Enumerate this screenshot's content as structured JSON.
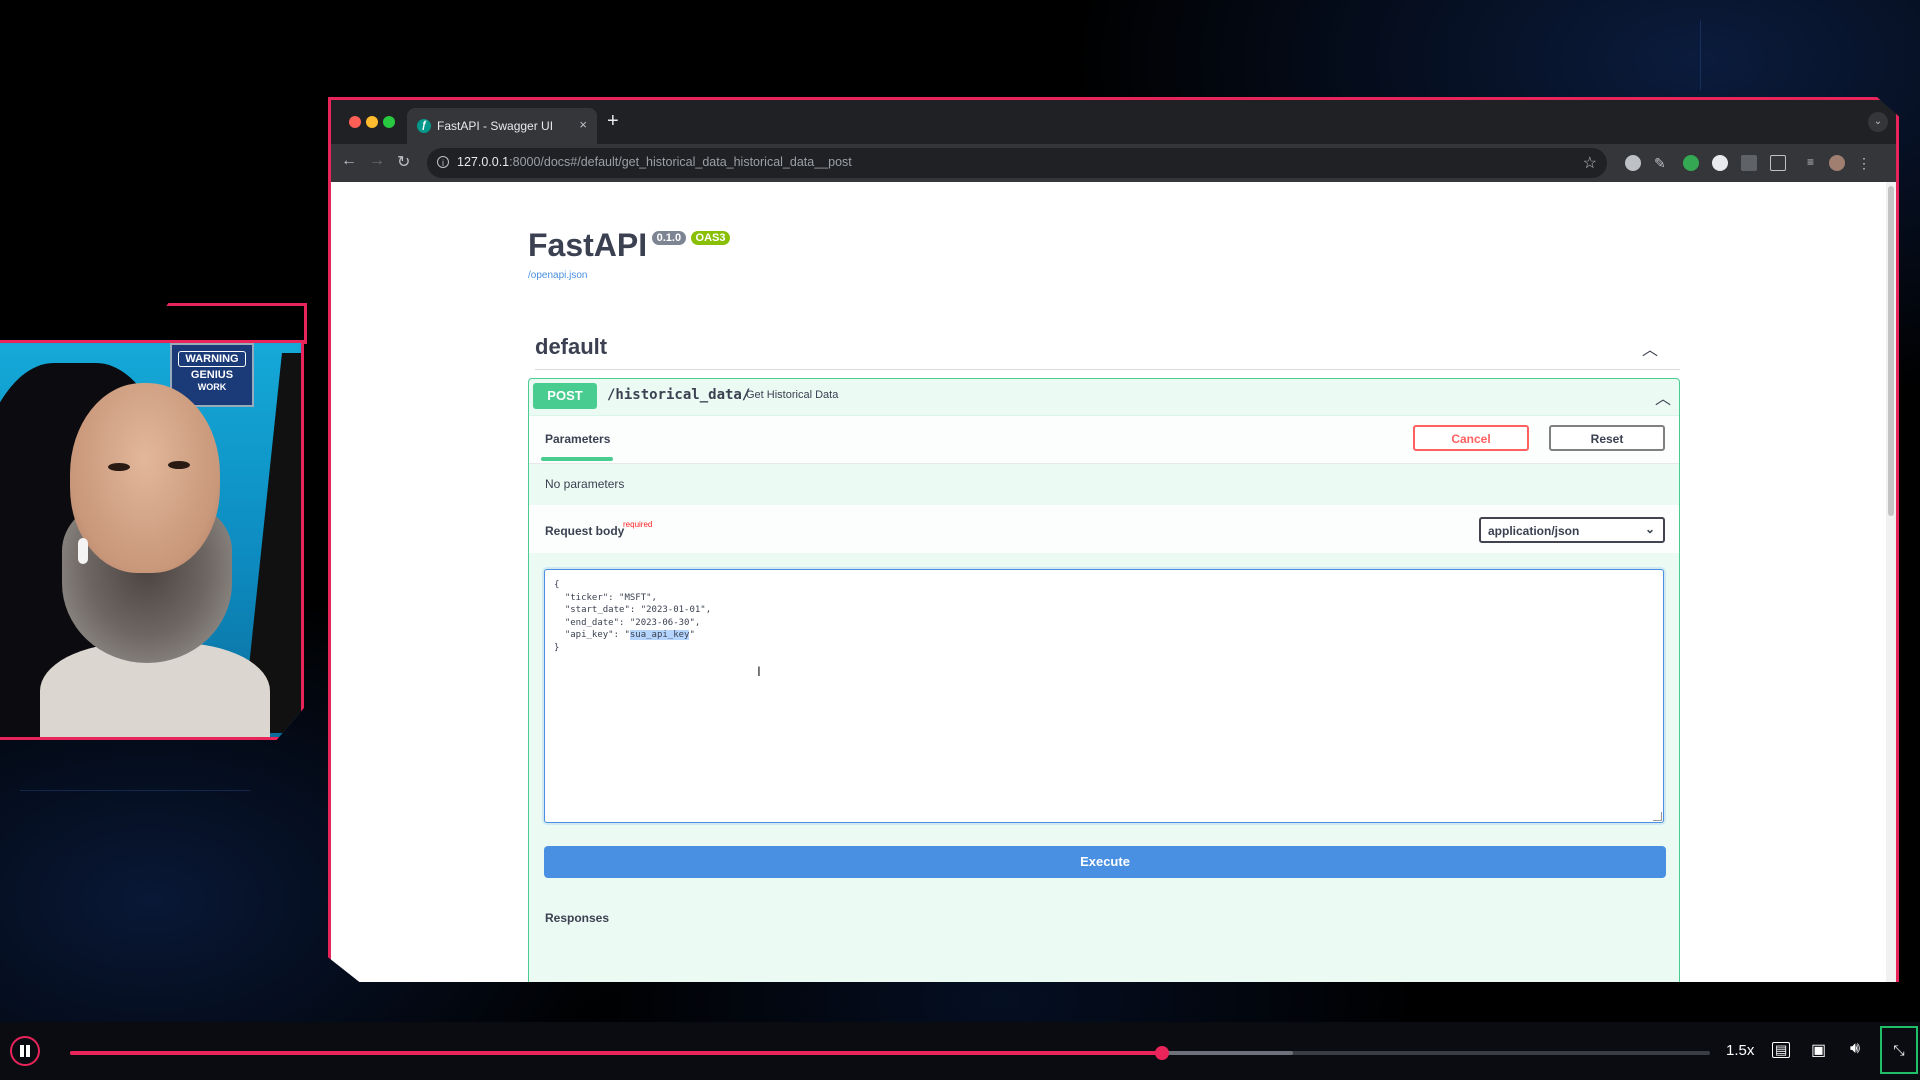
{
  "webcam": {
    "poster_line1": "WARNING",
    "poster_line2": "GENIUS",
    "poster_line3": "WORK"
  },
  "browser": {
    "tab_title": "FastAPI - Swagger UI",
    "tab_close": "×",
    "new_tab": "+",
    "url_host": "127.0.0.1",
    "url_rest": ":8000/docs#/default/get_historical_data_historical_data__post",
    "icons": [
      "back-icon",
      "forward-icon",
      "reload-icon",
      "info-icon",
      "star-icon",
      "extensions-icon",
      "menu-icon"
    ]
  },
  "swagger": {
    "app_title": "FastAPI",
    "version": "0.1.0",
    "oas": "OAS3",
    "spec_link": "/openapi.json",
    "section_title": "default",
    "operation": {
      "method": "POST",
      "path": "/historical_data/",
      "summary": "Get Historical Data"
    },
    "parameters_tab": "Parameters",
    "cancel_label": "Cancel",
    "reset_label": "Reset",
    "no_parameters": "No parameters",
    "request_body_label": "Request body",
    "required_label": "required",
    "content_type": "application/json",
    "body": {
      "open": "{",
      "ticker_line": "  \"ticker\": \"MSFT\",",
      "start_line": "  \"start_date\": \"2023-01-01\",",
      "end_line": "  \"end_date\": \"2023-06-30\",",
      "api_key_prefix": "  \"api_key\": \"",
      "api_key_value": "sua_api_key",
      "api_key_suffix": "\"",
      "close": "}"
    },
    "execute_label": "Execute",
    "responses_label": "Responses"
  },
  "player": {
    "speed": "1.5x",
    "progress": 0.666,
    "buffered": 0.746,
    "accent_color": "#e8245a"
  }
}
